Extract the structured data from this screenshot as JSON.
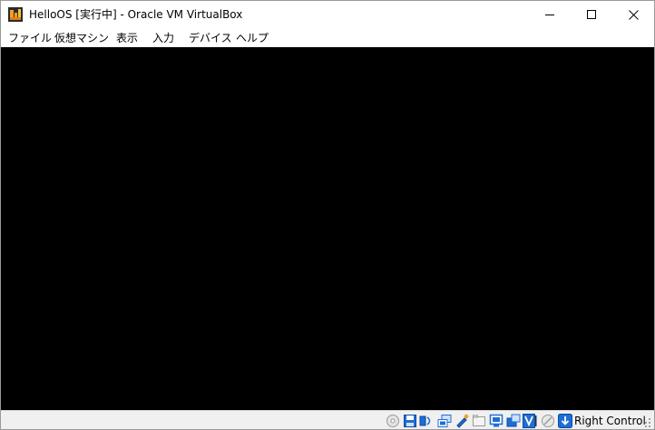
{
  "window": {
    "title": "HelloOS [実行中] - Oracle VM VirtualBox"
  },
  "menu": {
    "items": [
      "ファイル",
      "仮想マシン",
      "表示",
      "入力",
      "デバイス",
      "ヘルプ"
    ]
  },
  "statusbar": {
    "icons": [
      "optical-drive-icon",
      "floppy-drive-icon",
      "audio-icon",
      "network-icon",
      "usb-icon",
      "shared-folders-icon",
      "display-icon",
      "video-capture-icon",
      "virtualization-icon",
      "mouse-integration-icon",
      "keyboard-capture-icon"
    ],
    "host_key_label": "Right Control"
  },
  "colors": {
    "vm_screen_bg": "#000000",
    "accent_blue": "#1e6ed6",
    "icon_orange": "#f0a020"
  }
}
